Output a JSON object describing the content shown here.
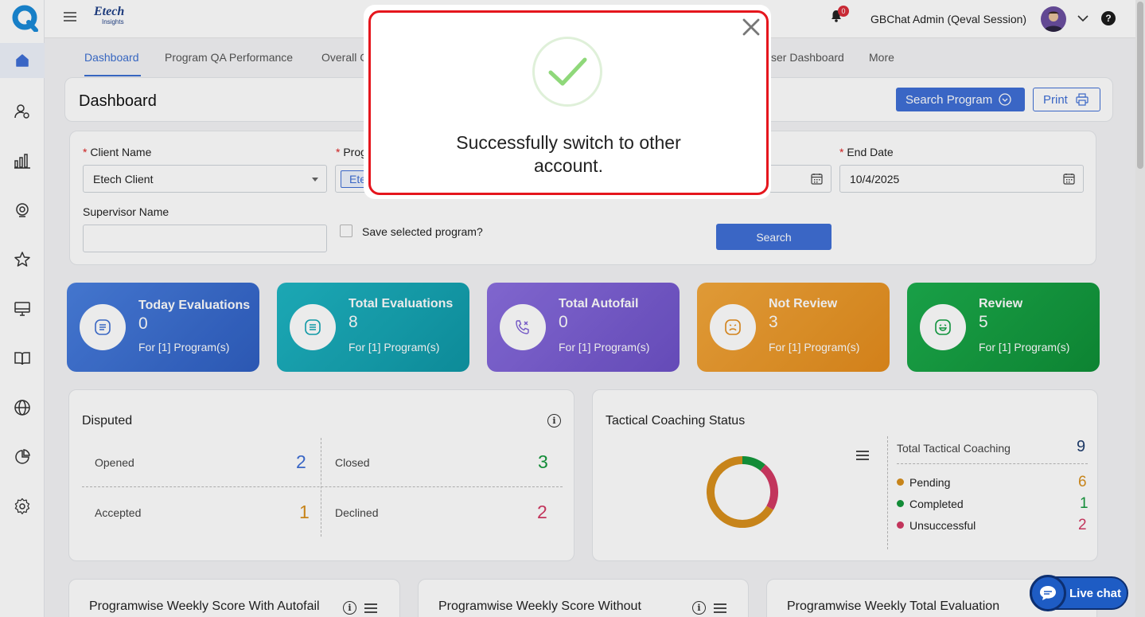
{
  "app": {
    "brand": "Etech",
    "brand_sub": "Insights"
  },
  "topbar": {
    "user_name": "GBChat Admin (Qeval Session)",
    "notif_count": "0",
    "help": "?"
  },
  "tabs": [
    {
      "label": "Dashboard"
    },
    {
      "label": "Program QA Performance"
    },
    {
      "label": "Overall C"
    },
    {
      "label": "ser Dashboard"
    },
    {
      "label": "More"
    }
  ],
  "header": {
    "title": "Dashboard",
    "search_program": "Search Program",
    "print": "Print"
  },
  "filters": {
    "client_name_label": "Client Name",
    "client_name_value": "Etech Client",
    "program_label": "Prog",
    "program_chip": "Ete",
    "end_date_label": "End Date",
    "end_date_value": "10/4/2025",
    "supervisor_label": "Supervisor Name",
    "supervisor_value": "",
    "save_program_label": "Save selected program?",
    "search_button": "Search",
    "required_mark": "*"
  },
  "stats": [
    {
      "title": "Today Evaluations",
      "value": "0",
      "sub": "For [1] Program(s)",
      "color": "#3f70d4"
    },
    {
      "title": "Total Evaluations",
      "value": "8",
      "sub": "For [1] Program(s)",
      "color": "#12a6b5"
    },
    {
      "title": "Total Autofail",
      "value": "0",
      "sub": "For [1] Program(s)",
      "color": "#7c5ed6"
    },
    {
      "title": "Not Review",
      "value": "3",
      "sub": "For [1] Program(s)",
      "color": "#ee9a2a"
    },
    {
      "title": "Review",
      "value": "5",
      "sub": "For [1] Program(s)",
      "color": "#12a043"
    }
  ],
  "disputed": {
    "title": "Disputed",
    "opened_label": "Opened",
    "opened_value": "2",
    "closed_label": "Closed",
    "closed_value": "3",
    "accepted_label": "Accepted",
    "accepted_value": "1",
    "declined_label": "Declined",
    "declined_value": "2"
  },
  "tactical": {
    "title": "Tactical Coaching Status",
    "total_label": "Total Tactical Coaching",
    "total_value": "9",
    "items": [
      {
        "label": "Pending",
        "value": "6",
        "color": "#d8901d"
      },
      {
        "label": "Completed",
        "value": "1",
        "color": "#14983c"
      },
      {
        "label": "Unsuccessful",
        "value": "2",
        "color": "#d33a64"
      }
    ]
  },
  "bottom_cards": [
    {
      "title": "Programwise Weekly Score With Autofail"
    },
    {
      "title": "Programwise Weekly Score Without"
    },
    {
      "title": "Programwise Weekly Total Evaluation"
    }
  ],
  "modal": {
    "message": "Successfully switch to other account."
  },
  "livechat": {
    "label": "Live chat"
  }
}
